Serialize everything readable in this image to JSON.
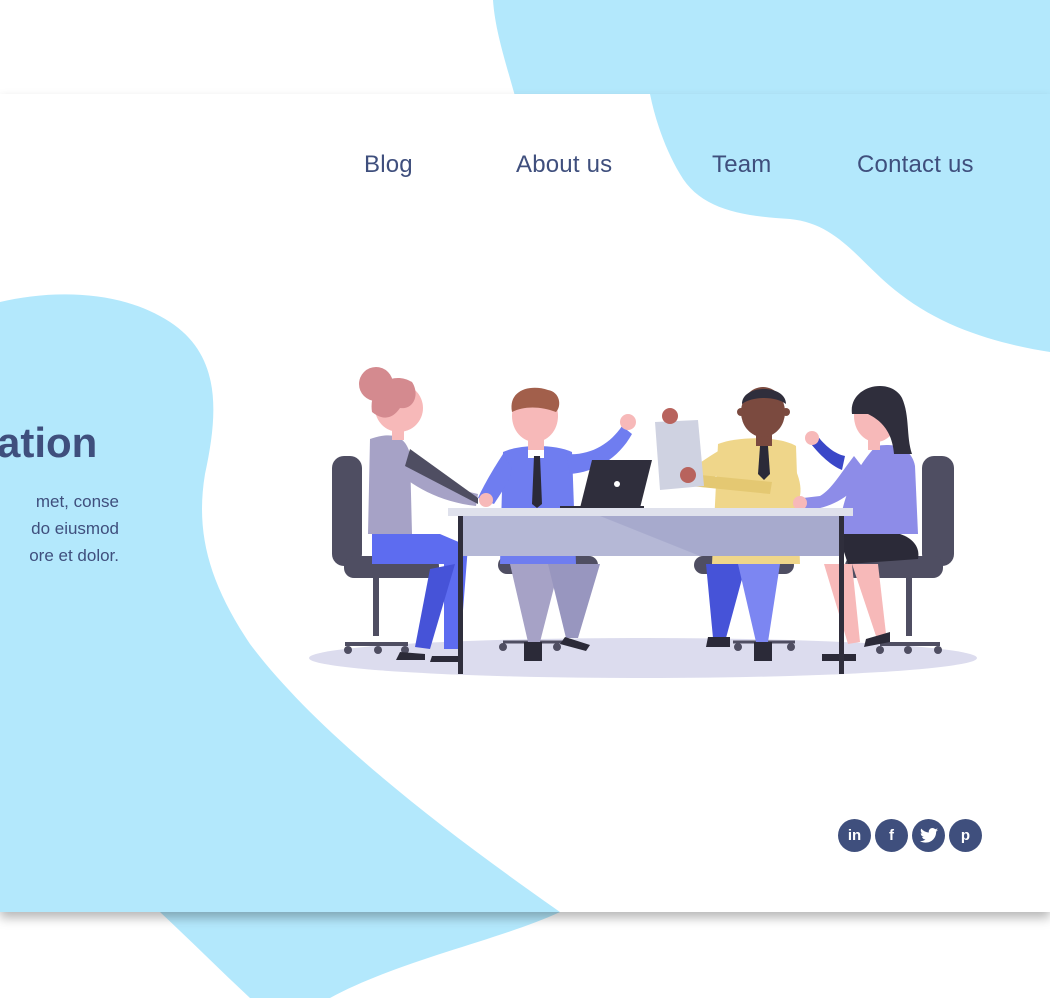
{
  "nav": {
    "items": [
      {
        "label": "Blog"
      },
      {
        "label": "About us"
      },
      {
        "label": "Team"
      },
      {
        "label": "Contact us"
      }
    ]
  },
  "hero": {
    "title_fragment": "ation",
    "text_lines": [
      "met, conse",
      "do eiusmod",
      "ore et dolor."
    ]
  },
  "social": {
    "items": [
      {
        "icon": "linkedin-icon",
        "glyph": "in"
      },
      {
        "icon": "facebook-icon",
        "glyph": "f"
      },
      {
        "icon": "twitter-icon",
        "glyph": "t"
      },
      {
        "icon": "pinterest-icon",
        "glyph": "p"
      }
    ]
  },
  "colors": {
    "accent_blob": "#b3e8fc",
    "text": "#3f4f7d",
    "shadow": "#9a9a9a"
  }
}
